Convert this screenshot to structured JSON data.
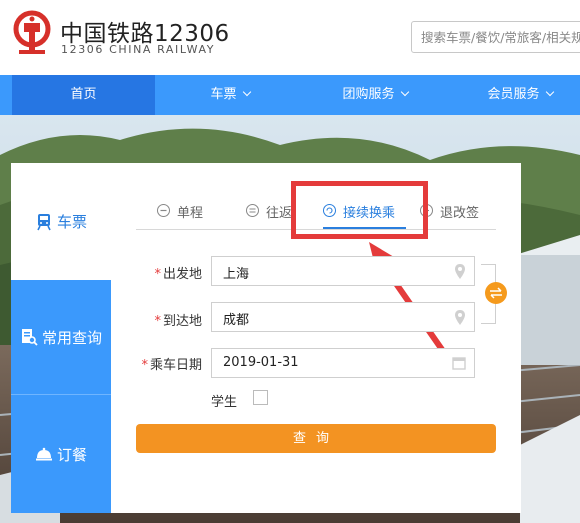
{
  "header": {
    "brand_cn": "中国铁路12306",
    "brand_en": "12306 CHINA RAILWAY",
    "search_placeholder": "搜索车票/餐饮/常旅客/相关规章"
  },
  "nav": {
    "items": [
      {
        "label": "首页",
        "active": true
      },
      {
        "label": "车票",
        "dropdown": true
      },
      {
        "label": "团购服务",
        "dropdown": true
      },
      {
        "label": "会员服务",
        "dropdown": true
      }
    ]
  },
  "sidebar": {
    "items": [
      {
        "label": "车票",
        "icon": "train-icon"
      },
      {
        "label": "常用查询",
        "icon": "document-search-icon"
      },
      {
        "label": "订餐",
        "icon": "food-cloche-icon"
      }
    ]
  },
  "tabs": [
    {
      "label": "单程"
    },
    {
      "label": "往返"
    },
    {
      "label": "接续换乘",
      "active": true
    },
    {
      "label": "退改签"
    }
  ],
  "form": {
    "from_label": "出发地",
    "from_value": "上海",
    "to_label": "到达地",
    "to_value": "成都",
    "date_label": "乘车日期",
    "date_value": "2019-01-31",
    "required_mark": "*",
    "student_label": "学生",
    "student_checked": false,
    "query_button": "查询"
  },
  "colors": {
    "primary_blue": "#3b99fc",
    "active_blue": "#2676e3",
    "accent_orange": "#f39322",
    "highlight_red": "#e43b3b"
  }
}
